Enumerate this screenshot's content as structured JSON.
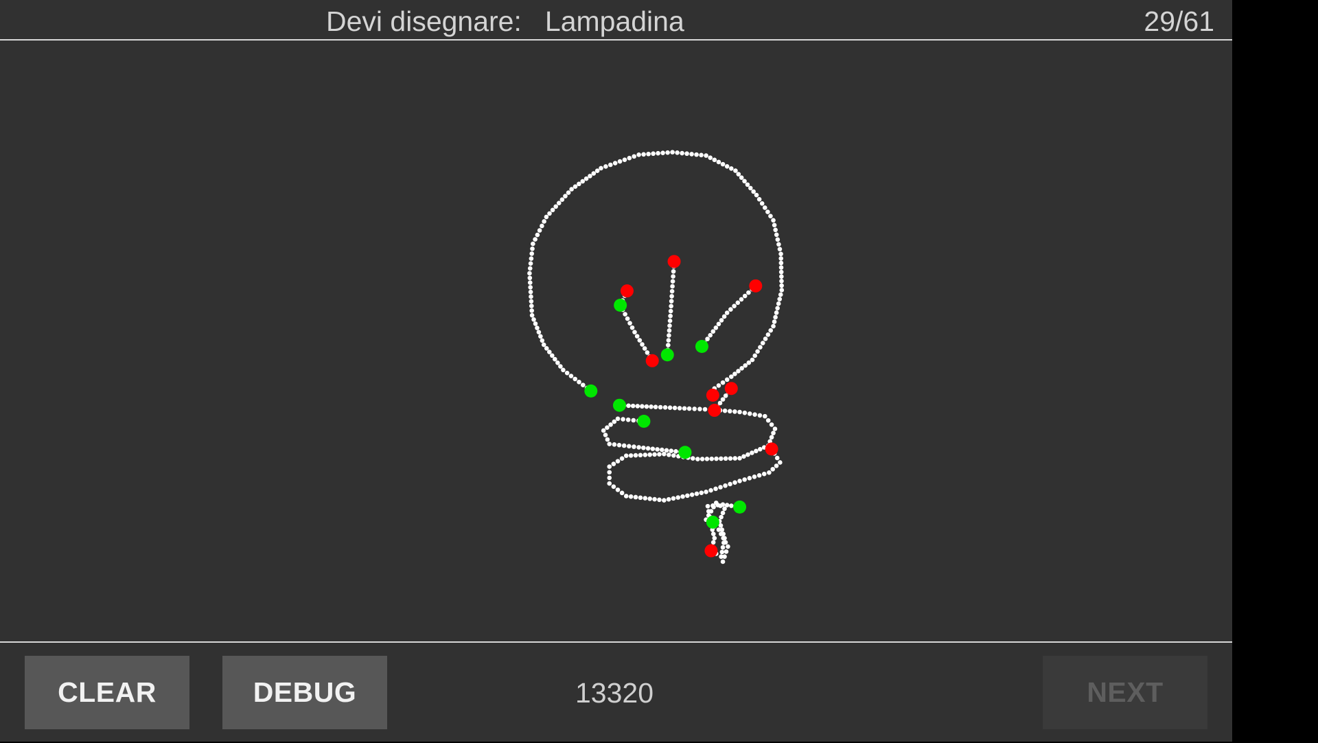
{
  "header": {
    "prompt_label": "Devi disegnare:",
    "prompt_word": "Lampadina",
    "progress": "29/61"
  },
  "footer": {
    "clear_label": "CLEAR",
    "debug_label": "DEBUG",
    "score": "13320",
    "next_label": "NEXT",
    "next_enabled": false
  },
  "drawing": {
    "stroke_color": "#ffffff",
    "start_marker_color": "#00e600",
    "end_marker_color": "#ff0000",
    "stroke_count": 10
  }
}
